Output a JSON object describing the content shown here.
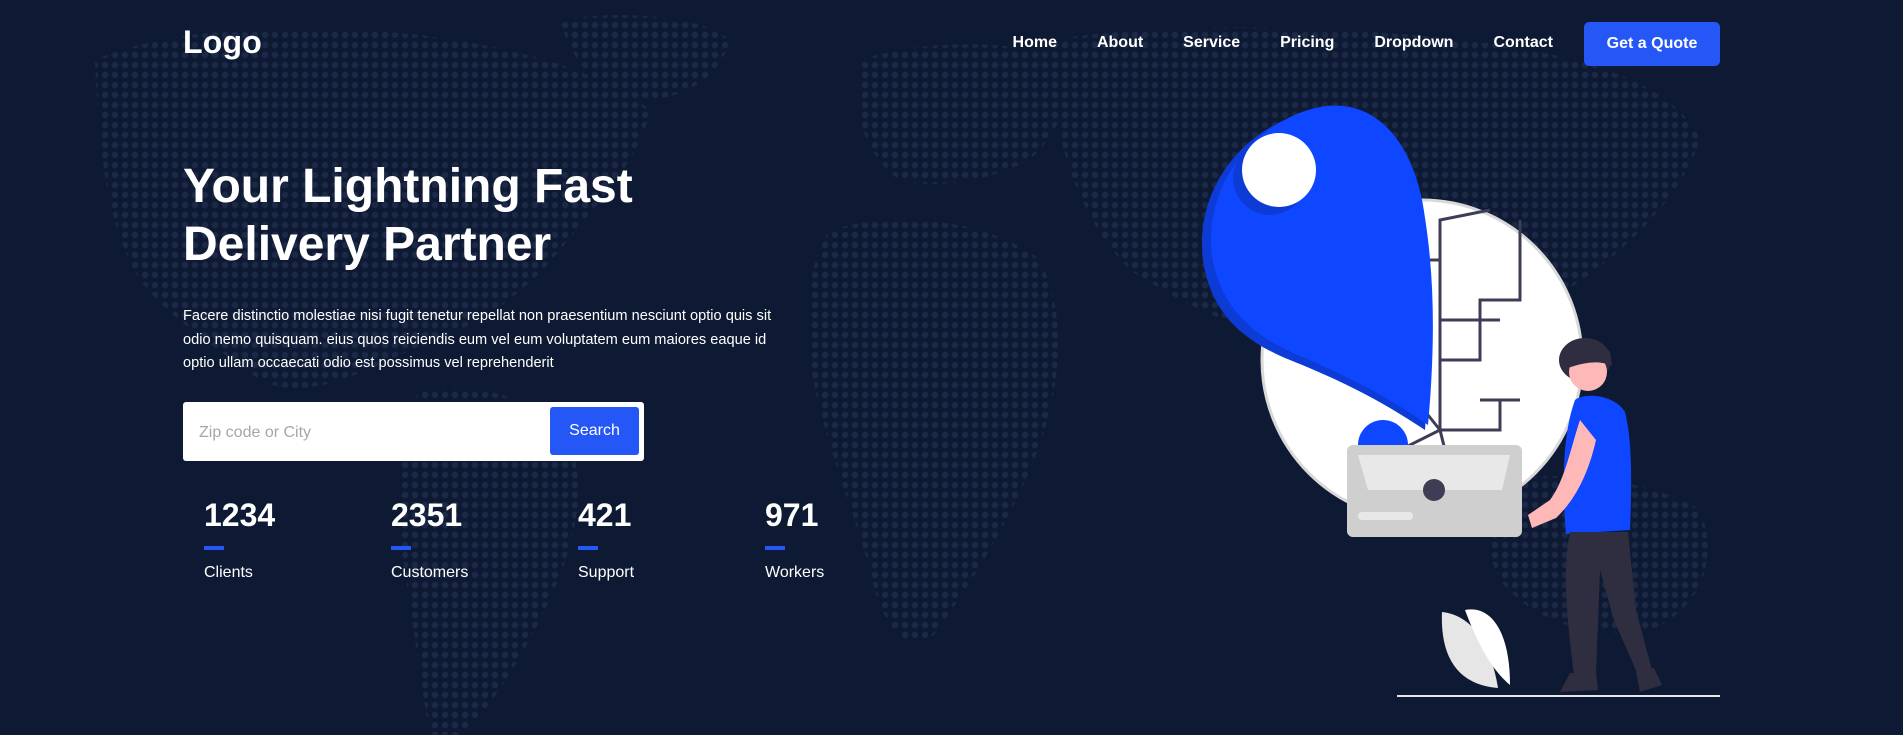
{
  "header": {
    "logo": "Logo",
    "nav": [
      {
        "label": "Home"
      },
      {
        "label": "About"
      },
      {
        "label": "Service"
      },
      {
        "label": "Pricing"
      },
      {
        "label": "Dropdown"
      },
      {
        "label": "Contact"
      }
    ],
    "cta_label": "Get a Quote"
  },
  "hero": {
    "title_line1": "Your Lightning Fast",
    "title_line2": "Delivery Partner",
    "description": "Facere distinctio molestiae nisi fugit tenetur repellat non praesentium nesciunt optio quis sit odio nemo quisquam. eius quos reiciendis eum vel eum voluptatem eum maiores eaque id optio ullam occaecati odio est possimus vel reprehenderit",
    "search": {
      "placeholder": "Zip code or City",
      "value": "",
      "button_label": "Search"
    },
    "stats": [
      {
        "value": "1234",
        "label": "Clients"
      },
      {
        "value": "2351",
        "label": "Customers"
      },
      {
        "value": "421",
        "label": "Support"
      },
      {
        "value": "971",
        "label": "Workers"
      }
    ]
  },
  "colors": {
    "background": "#0e1a33",
    "accent": "#2457f5",
    "map_dots": "#1c2a47",
    "pin": "#0f46ff"
  },
  "icons": {
    "map_pin": "location-pin-icon",
    "illustration": "delivery-person-illustration",
    "background": "world-map-dots"
  }
}
